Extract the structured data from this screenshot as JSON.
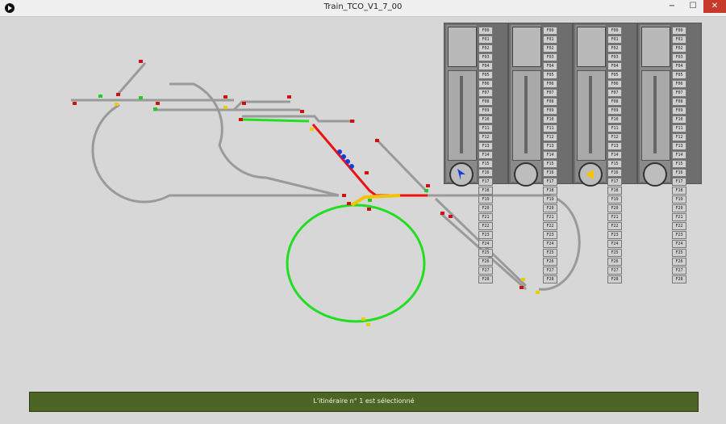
{
  "window": {
    "title": "Train_TCO_V1_7_00",
    "minimize": "−",
    "maximize": "☐",
    "close": "✕"
  },
  "throttles": [
    {
      "functions": [
        "F00",
        "F01",
        "F02",
        "F03",
        "F04",
        "F05",
        "F06",
        "F07",
        "F08",
        "F09",
        "F10",
        "F11",
        "F12",
        "F13",
        "F14",
        "F15",
        "F16",
        "F17",
        "F18",
        "F19",
        "F20",
        "F21",
        "F22",
        "F23",
        "F24",
        "F25",
        "F26",
        "F27",
        "F28"
      ],
      "direction_color": "#1a3dd8"
    },
    {
      "functions": [
        "F00",
        "F01",
        "F02",
        "F03",
        "F04",
        "F05",
        "F06",
        "F07",
        "F08",
        "F09",
        "F10",
        "F11",
        "F12",
        "F13",
        "F14",
        "F15",
        "F16",
        "F17",
        "F18",
        "F19",
        "F20",
        "F21",
        "F22",
        "F23",
        "F24",
        "F25",
        "F26",
        "F27",
        "F28"
      ],
      "direction_color": ""
    },
    {
      "functions": [
        "F00",
        "F01",
        "F02",
        "F03",
        "F04",
        "F05",
        "F06",
        "F07",
        "F08",
        "F09",
        "F10",
        "F11",
        "F12",
        "F13",
        "F14",
        "F15",
        "F16",
        "F17",
        "F18",
        "F19",
        "F20",
        "F21",
        "F22",
        "F23",
        "F24",
        "F25",
        "F26",
        "F27",
        "F28"
      ],
      "direction_color": "#f2c400"
    },
    {
      "functions": [
        "F00",
        "F01",
        "F02",
        "F03",
        "F04",
        "F05",
        "F06",
        "F07",
        "F08",
        "F09",
        "F10",
        "F11",
        "F12",
        "F13",
        "F14",
        "F15",
        "F16",
        "F17",
        "F18",
        "F19",
        "F20",
        "F21",
        "F22",
        "F23",
        "F24",
        "F25",
        "F26",
        "F27",
        "F28"
      ],
      "direction_color": ""
    }
  ],
  "status": {
    "message": "L'itinéraire n° 1 est sélectionné"
  },
  "colors": {
    "track": "#9a9a9a",
    "route_active": "#22dd22",
    "route_red": "#ee1111",
    "route_yellow": "#f2c400",
    "train": "#1a3dd8",
    "status_bg": "#4c6424"
  }
}
